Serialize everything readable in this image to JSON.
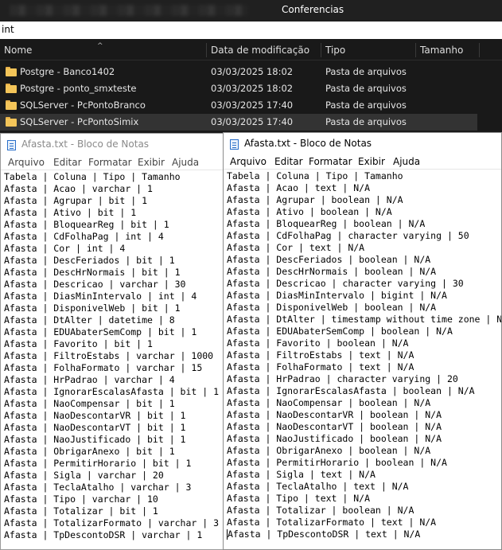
{
  "explorer": {
    "tab_title": "Conferencias",
    "address_fragment": "int",
    "columns": [
      "Nome",
      "Data de modificação",
      "Tipo",
      "Tamanho"
    ],
    "rows": [
      {
        "name": "Postgre - Banco1402",
        "date": "03/03/2025 18:02",
        "type": "Pasta de arquivos",
        "selected": false
      },
      {
        "name": "Postgre - ponto_smxteste",
        "date": "03/03/2025 18:02",
        "type": "Pasta de arquivos",
        "selected": false
      },
      {
        "name": "SQLServer - PcPontoBranco",
        "date": "03/03/2025 17:40",
        "type": "Pasta de arquivos",
        "selected": false
      },
      {
        "name": "SQLServer - PcPontoSimix",
        "date": "03/03/2025 17:40",
        "type": "Pasta de arquivos",
        "selected": true
      }
    ],
    "icons": {
      "folder": "folder-icon",
      "sort": "sort-up-icon"
    },
    "colors": {
      "folder": "#f4c559",
      "selected_row": "#333333"
    }
  },
  "notepad_left": {
    "title": "Afasta.txt - Bloco de Notas",
    "menu": [
      "Arquivo",
      "Editar",
      "Formatar",
      "Exibir",
      "Ajuda"
    ],
    "lines": [
      "Tabela | Coluna | Tipo | Tamanho",
      "Afasta | Acao | varchar | 1",
      "Afasta | Agrupar | bit | 1",
      "Afasta | Ativo | bit | 1",
      "Afasta | BloquearReg | bit | 1",
      "Afasta | CdFolhaPag | int | 4",
      "Afasta | Cor | int | 4",
      "Afasta | DescFeriados | bit | 1",
      "Afasta | DescHrNormais | bit | 1",
      "Afasta | Descricao | varchar | 30",
      "Afasta | DiasMinIntervalo | int | 4",
      "Afasta | DisponivelWeb | bit | 1",
      "Afasta | DtAlter | datetime | 8",
      "Afasta | EDUAbaterSemComp | bit | 1",
      "Afasta | Favorito | bit | 1",
      "Afasta | FiltroEstabs | varchar | 1000",
      "Afasta | FolhaFormato | varchar | 15",
      "Afasta | HrPadrao | varchar | 4",
      "Afasta | IgnorarEscalasAfasta | bit | 1",
      "Afasta | NaoCompensar | bit | 1",
      "Afasta | NaoDescontarVR | bit | 1",
      "Afasta | NaoDescontarVT | bit | 1",
      "Afasta | NaoJustificado | bit | 1",
      "Afasta | ObrigarAnexo | bit | 1",
      "Afasta | PermitirHorario | bit | 1",
      "Afasta | Sigla | varchar | 20",
      "Afasta | TeclaAtalho | varchar | 3",
      "Afasta | Tipo | varchar | 10",
      "Afasta | Totalizar | bit | 1",
      "Afasta | TotalizarFormato | varchar | 3",
      "Afasta | TpDescontoDSR | varchar | 1"
    ]
  },
  "notepad_right": {
    "title": "Afasta.txt - Bloco de Notas",
    "menu": [
      "Arquivo",
      "Editar",
      "Formatar",
      "Exibir",
      "Ajuda"
    ],
    "lines": [
      "Tabela | Coluna | Tipo | Tamanho",
      "Afasta | Acao | text | N/A",
      "Afasta | Agrupar | boolean | N/A",
      "Afasta | Ativo | boolean | N/A",
      "Afasta | BloquearReg | boolean | N/A",
      "Afasta | CdFolhaPag | character varying | 50",
      "Afasta | Cor | text | N/A",
      "Afasta | DescFeriados | boolean | N/A",
      "Afasta | DescHrNormais | boolean | N/A",
      "Afasta | Descricao | character varying | 30",
      "Afasta | DiasMinIntervalo | bigint | N/A",
      "Afasta | DisponivelWeb | boolean | N/A",
      "Afasta | DtAlter | timestamp without time zone | N/A",
      "Afasta | EDUAbaterSemComp | boolean | N/A",
      "Afasta | Favorito | boolean | N/A",
      "Afasta | FiltroEstabs | text | N/A",
      "Afasta | FolhaFormato | text | N/A",
      "Afasta | HrPadrao | character varying | 20",
      "Afasta | IgnorarEscalasAfasta | boolean | N/A",
      "Afasta | NaoCompensar | boolean | N/A",
      "Afasta | NaoDescontarVR | boolean | N/A",
      "Afasta | NaoDescontarVT | boolean | N/A",
      "Afasta | NaoJustificado | boolean | N/A",
      "Afasta | ObrigarAnexo | boolean | N/A",
      "Afasta | PermitirHorario | boolean | N/A",
      "Afasta | Sigla | text | N/A",
      "Afasta | TeclaAtalho | text | N/A",
      "Afasta | Tipo | text | N/A",
      "Afasta | Totalizar | boolean | N/A",
      "Afasta | TotalizarFormato | text | N/A",
      "Afasta | TpDescontoDSR | text | N/A"
    ]
  }
}
